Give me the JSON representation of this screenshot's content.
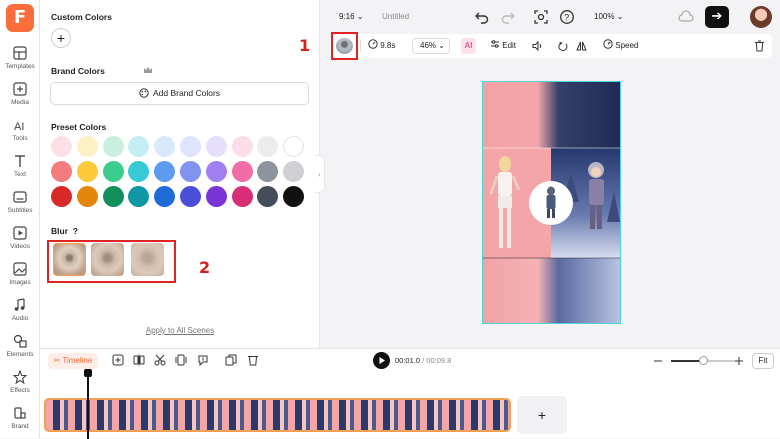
{
  "nav": {
    "logo": "F",
    "items": [
      {
        "label": "Templates",
        "icon": "templates-icon"
      },
      {
        "label": "Media",
        "icon": "media-icon"
      },
      {
        "label": "Tools",
        "icon": "ai-tools-icon"
      },
      {
        "label": "Text",
        "icon": "text-icon"
      },
      {
        "label": "Subtitles",
        "icon": "subtitles-icon"
      },
      {
        "label": "Videos",
        "icon": "videos-icon"
      },
      {
        "label": "Images",
        "icon": "images-icon"
      },
      {
        "label": "Audio",
        "icon": "audio-icon"
      },
      {
        "label": "Elements",
        "icon": "elements-icon"
      },
      {
        "label": "Effects",
        "icon": "effects-icon"
      },
      {
        "label": "Brand",
        "icon": "brand-icon"
      }
    ]
  },
  "panel": {
    "custom_colors_title": "Custom Colors",
    "add_custom_label": "+",
    "brand_colors_title": "Brand Colors",
    "add_brand_colors": "Add Brand Colors",
    "preset_colors_title": "Preset Colors",
    "preset_colors": [
      "#fde0e6",
      "#fdf0c2",
      "#c9f0de",
      "#c4eef3",
      "#d9e8fb",
      "#dfe3fb",
      "#e6dffb",
      "#fbdde9",
      "#ececee",
      "#ffffff",
      "#f47b7e",
      "#fbc93a",
      "#3ccc8e",
      "#37c9d4",
      "#5e9bf0",
      "#7f93ef",
      "#a07ff0",
      "#ee6ea5",
      "#8e949e",
      "#d0d0d4",
      "#d82828",
      "#e2860c",
      "#138f5c",
      "#0f97a5",
      "#1f6cd9",
      "#4a4fd8",
      "#7a35d9",
      "#d72e77",
      "#454d5a",
      "#111111"
    ],
    "blur_title": "Blur",
    "blur_help": "?",
    "apply_all": "Apply to All Scenes"
  },
  "topbar": {
    "aspect": "9:16",
    "title": "Untitled",
    "zoom": "100%"
  },
  "toolbar": {
    "duration": "9.8s",
    "scale": "46%",
    "ai_label": "AI",
    "edit": "Edit",
    "speed": "Speed"
  },
  "callouts": {
    "one": "1",
    "two": "2"
  },
  "timeline": {
    "tag": "Timeline",
    "current": "00:01.0",
    "total": " / 00:09.8",
    "fit": "Fit",
    "zoom_level": 0.5,
    "add": "+"
  },
  "colors": {
    "accent": "#fb6d3a",
    "callout": "#e02424",
    "canvas_border": "#4fd3dd"
  }
}
